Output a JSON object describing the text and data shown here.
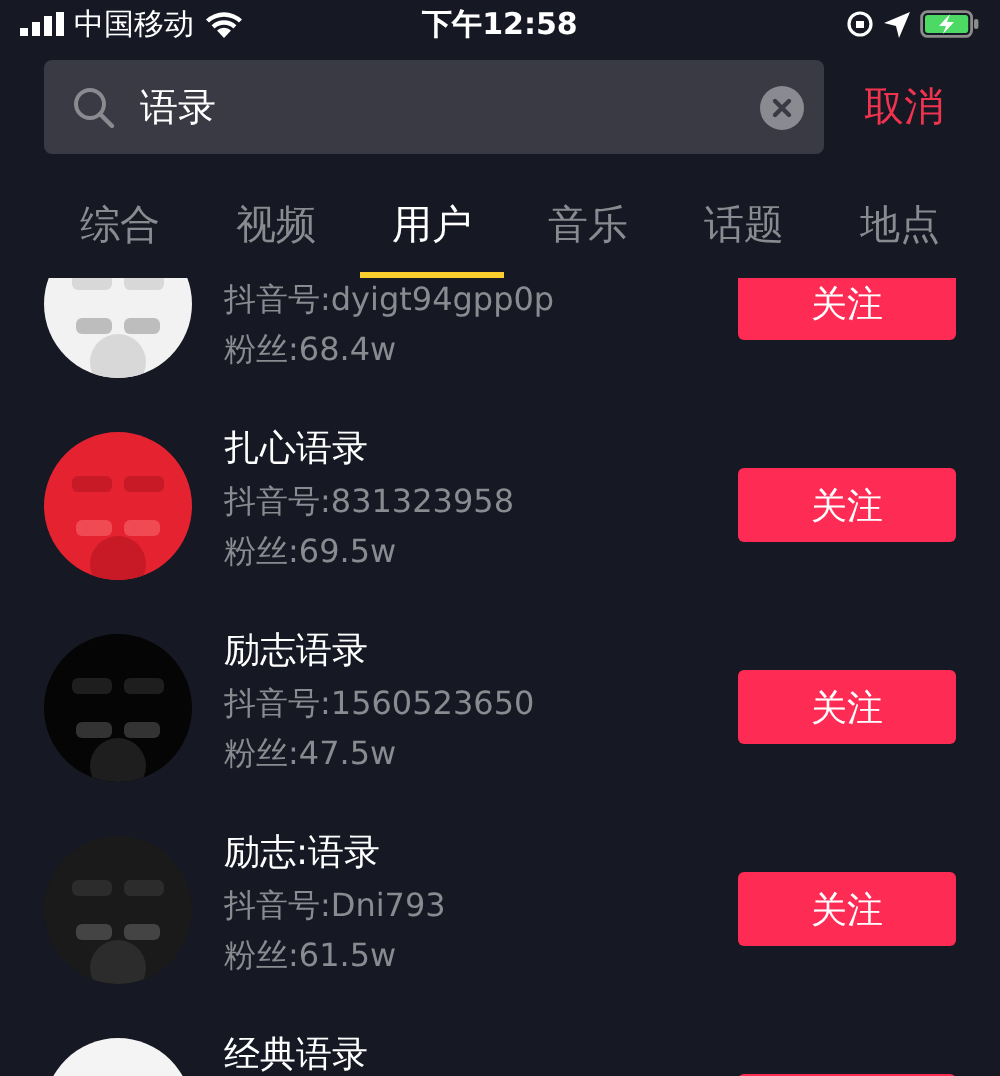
{
  "status_bar": {
    "carrier": "中国移动",
    "time": "下午12:58"
  },
  "search": {
    "value": "语录",
    "cancel": "取消"
  },
  "tabs": [
    {
      "label": "综合",
      "selected": false
    },
    {
      "label": "视频",
      "selected": false
    },
    {
      "label": "用户",
      "selected": true
    },
    {
      "label": "音乐",
      "selected": false
    },
    {
      "label": "话题",
      "selected": false
    },
    {
      "label": "地点",
      "selected": false
    }
  ],
  "users": [
    {
      "handle": "抖音号:dyigt94gpp0p",
      "fans": "粉丝:68.4w",
      "follow": "关注"
    },
    {
      "name": "扎心语录",
      "handle": "抖音号:831323958",
      "fans": "粉丝:69.5w",
      "follow": "关注"
    },
    {
      "name": "励志语录",
      "handle": "抖音号:1560523650",
      "fans": "粉丝:47.5w",
      "follow": "关注"
    },
    {
      "name": "励志:语录",
      "handle": "抖音号:Dni793",
      "fans": "粉丝:61.5w",
      "follow": "关注"
    },
    {
      "name": "经典语录"
    }
  ]
}
